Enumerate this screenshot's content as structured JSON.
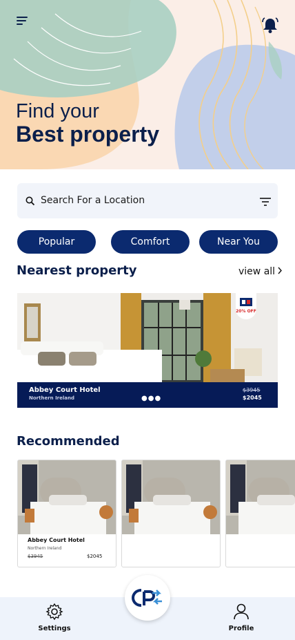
{
  "hero": {
    "title_line1": "Find your",
    "title_line2": "Best property"
  },
  "search": {
    "placeholder": "Search For a Location"
  },
  "filters": [
    "Popular",
    "Comfort",
    "Near You"
  ],
  "nearest": {
    "title": "Nearest property",
    "view_all": "view all",
    "featured": {
      "name": "Abbey Court Hotel",
      "location": "Northern Ireland",
      "old_price": "$3945",
      "new_price": "$2045",
      "badge": "20% OFF"
    }
  },
  "recommended": {
    "title": "Recommended",
    "items": [
      {
        "name": "Abbey Court Hotel",
        "location": "Northern Ireland",
        "old_price": "$3945",
        "new_price": "$2045"
      },
      {
        "name": "",
        "location": "",
        "old_price": "",
        "new_price": ""
      },
      {
        "name": "",
        "location": "",
        "old_price": "",
        "new_price": ""
      }
    ]
  },
  "bottom_nav": {
    "settings": "Settings",
    "profile": "Profile",
    "center_icon": "cp-logo-icon"
  },
  "colors": {
    "primary": "#0b2a6f",
    "hero_peach": "#fbd9b4",
    "hero_green": "#a9cfc2",
    "hero_blue": "#c2cfea",
    "nav_bg": "#eef3fb"
  }
}
